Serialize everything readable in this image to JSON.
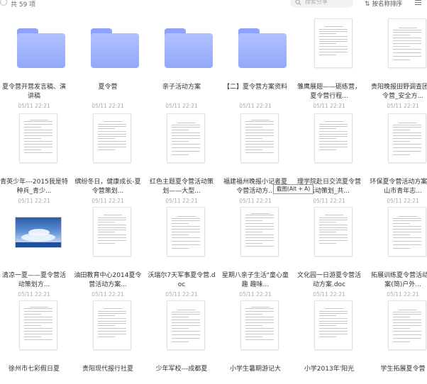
{
  "header": {
    "count_label": "共 59 项",
    "search_placeholder": "搜索分享",
    "sort_label": "按名称排序"
  },
  "tooltip": "截图(Alt + A)",
  "files": [
    {
      "type": "folder",
      "name": "夏令营开营发言稿、演讲稿",
      "date": "05/11 22:21"
    },
    {
      "type": "folder",
      "name": "夏令营",
      "date": "05/11 22:21"
    },
    {
      "type": "folder",
      "name": "亲子活动方案",
      "date": "05/11 22:21"
    },
    {
      "type": "folder",
      "name": "【二】夏令营方案资料",
      "date": "05/11 22:21"
    },
    {
      "type": "doc",
      "name": "雏鹰展翅——砺练营，夏令营行程...",
      "date": "05/11 22:21"
    },
    {
      "type": "doc",
      "name": "贵阳晚报田野调查团夏令营_安全方...",
      "date": "05/11 22:21"
    },
    {
      "type": "doc",
      "name": "青英少年---2015我是特种兵_青少...",
      "date": "05/11 22:21"
    },
    {
      "type": "doc",
      "name": "缤纷冬日，健康成长-夏令营策划...",
      "date": "05/11 22:21"
    },
    {
      "type": "doc",
      "name": "红色主题夏令营活动策划——大型...",
      "date": "05/11 22:21"
    },
    {
      "type": "doc",
      "name": "福建福州晚报小记者夏令营活动方...",
      "date": "05/11 22:21"
    },
    {
      "type": "doc",
      "name": "理学院赴日交流夏令营活动策划_共...",
      "date": "05/11 22:21"
    },
    {
      "type": "doc",
      "name": "环保夏令营活动方案-中山市青年志...",
      "date": "05/11 22:21"
    },
    {
      "type": "photo",
      "name": "清凉一夏——夏令营活动策划方...",
      "date": "05/11 22:21"
    },
    {
      "type": "doc",
      "name": "油田教育中心2014夏令营活动方案...",
      "date": "05/11 22:21"
    },
    {
      "type": "doc",
      "name": "沃瑞尔7天军事夏令营.doc",
      "date": "05/11 22:21"
    },
    {
      "type": "doc",
      "name": "星期八亲子生活\"童心童趣 趣味...",
      "date": "05/11 22:21"
    },
    {
      "type": "doc",
      "name": "文化园一日游夏令营活动方案.doc",
      "date": "05/11 22:21"
    },
    {
      "type": "doc",
      "name": "拓展训练夏令营活动方案(简)户外...",
      "date": "05/11 22:21"
    },
    {
      "type": "doc",
      "name": "徐州市七彩假日夏",
      "date": ""
    },
    {
      "type": "doc",
      "name": "贵阳现代报行社夏",
      "date": ""
    },
    {
      "type": "doc",
      "name": "少年军校---成都夏",
      "date": ""
    },
    {
      "type": "doc",
      "name": "小学生暑期游记大",
      "date": ""
    },
    {
      "type": "doc",
      "name": "小学2013年'阳光",
      "date": ""
    },
    {
      "type": "doc",
      "name": "学生拓展夏令营",
      "date": ""
    }
  ]
}
